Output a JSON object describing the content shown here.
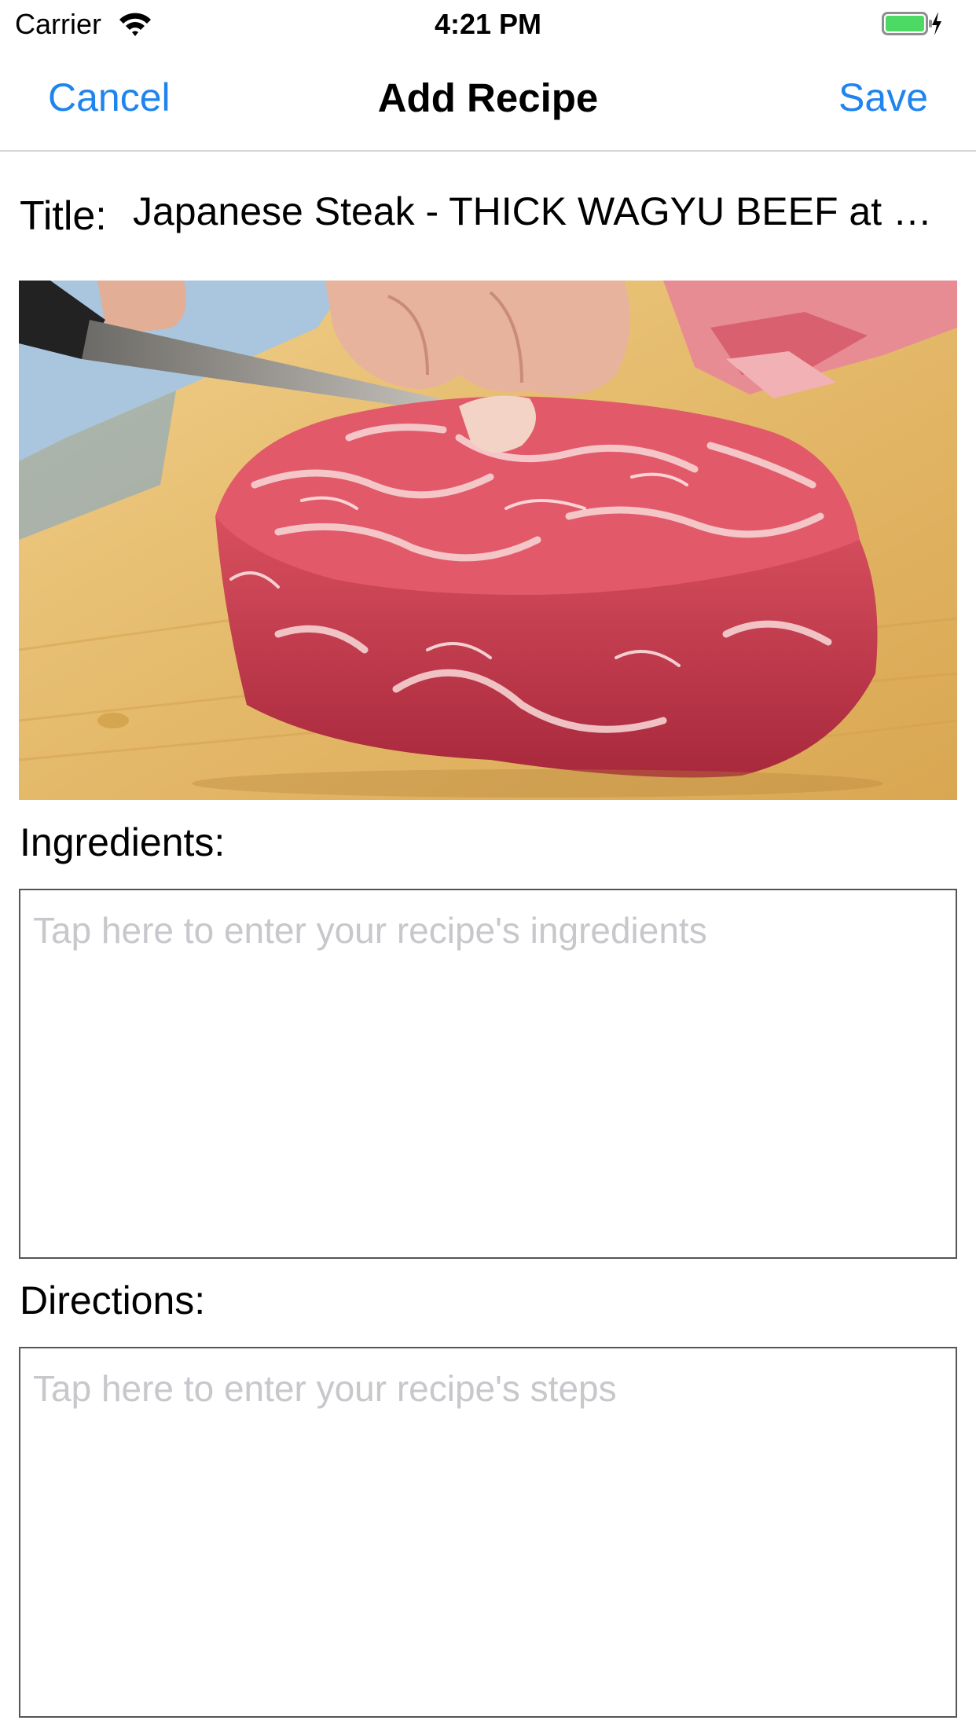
{
  "status_bar": {
    "carrier": "Carrier",
    "time": "4:21 PM",
    "battery_color": "#4cd964"
  },
  "nav_bar": {
    "cancel_label": "Cancel",
    "title": "Add Recipe",
    "save_label": "Save",
    "accent_color": "#1f84f0"
  },
  "recipe": {
    "title_label": "Title:",
    "title_value": "Japanese Steak - THICK WAGYU BEEF at S...",
    "photo_subject": "marbled wagyu steak being sliced on a wooden cutting board",
    "ingredients_label": "Ingredients:",
    "ingredients_placeholder": "Tap here to enter your recipe's ingredients",
    "directions_label": "Directions:",
    "directions_placeholder": "Tap here to enter your recipe's steps"
  }
}
